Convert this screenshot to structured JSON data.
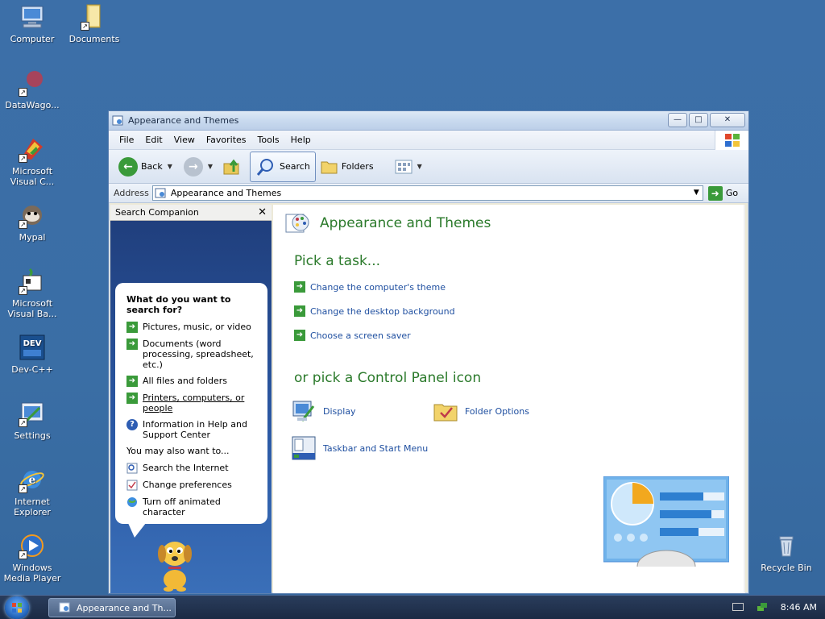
{
  "desktop": {
    "icons": [
      {
        "label": "Computer",
        "icon": "computer-icon"
      },
      {
        "label": "Documents",
        "icon": "documents-folder-icon"
      },
      {
        "label": "DataWago...",
        "icon": "datawagon-icon"
      },
      {
        "label": "Microsoft Visual C...",
        "icon": "visual-c-icon"
      },
      {
        "label": "Mypal",
        "icon": "mypal-icon"
      },
      {
        "label": "Microsoft Visual Ba...",
        "icon": "visual-basic-icon"
      },
      {
        "label": "Dev-C++",
        "icon": "devcpp-icon"
      },
      {
        "label": "Settings",
        "icon": "settings-icon"
      },
      {
        "label": "Internet Explorer",
        "icon": "internet-explorer-icon"
      },
      {
        "label": "Windows Media Player",
        "icon": "media-player-icon"
      },
      {
        "label": "Recycle Bin",
        "icon": "recycle-bin-icon"
      }
    ],
    "dev_badge": "DEV"
  },
  "window": {
    "title": "Appearance and Themes",
    "controls": {
      "minimize": "—",
      "maximize": "□",
      "close": "✕"
    },
    "menu": [
      "File",
      "Edit",
      "View",
      "Favorites",
      "Tools",
      "Help"
    ],
    "toolbar": {
      "back": "Back",
      "search": "Search",
      "folders": "Folders"
    },
    "address": {
      "label": "Address",
      "value": "Appearance and Themes",
      "go": "Go"
    }
  },
  "search_companion": {
    "header": "Search Companion",
    "question": "What do you want to search for?",
    "options": [
      "Pictures, music, or video",
      "Documents (word processing, spreadsheet, etc.)",
      "All files and folders",
      "Printers, computers, or people",
      "Information in Help and Support Center"
    ],
    "also_label": "You may also want to...",
    "also_options": [
      "Search the Internet",
      "Change preferences",
      "Turn off animated character"
    ]
  },
  "content": {
    "title": "Appearance and Themes",
    "pick_task": "Pick a task...",
    "tasks": [
      "Change the computer's theme",
      "Change the desktop background",
      "Choose a screen saver"
    ],
    "pick_icon": "or pick a Control Panel icon",
    "icons": [
      {
        "label": "Display",
        "icon": "display-icon"
      },
      {
        "label": "Folder Options",
        "icon": "folder-options-icon"
      },
      {
        "label": "Taskbar and Start Menu",
        "icon": "taskbar-icon"
      }
    ]
  },
  "taskbar": {
    "task_button": "Appearance and Th...",
    "clock": "8:46 AM"
  },
  "colors": {
    "desktop": "#3a6ea5",
    "heading_green": "#2b7a2b",
    "link_blue": "#1f4fa0",
    "arrow_green": "#3a9a3a"
  }
}
